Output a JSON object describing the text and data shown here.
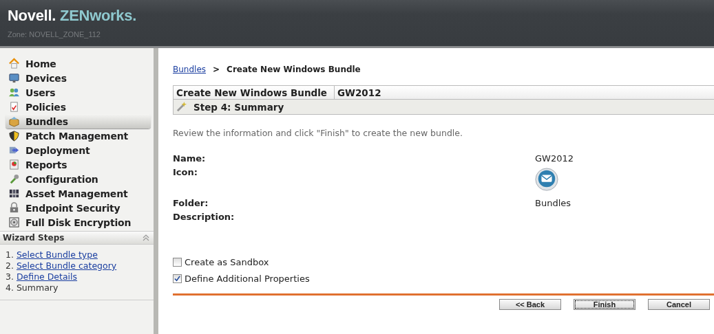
{
  "header": {
    "brand": "Novell.",
    "product": "ZENworks.",
    "zone": "Zone: NOVELL_ZONE_112"
  },
  "nav": {
    "items": [
      {
        "label": "Home",
        "selected": false
      },
      {
        "label": "Devices",
        "selected": false
      },
      {
        "label": "Users",
        "selected": false
      },
      {
        "label": "Policies",
        "selected": false
      },
      {
        "label": "Bundles",
        "selected": true
      },
      {
        "label": "Patch Management",
        "selected": false
      },
      {
        "label": "Deployment",
        "selected": false
      },
      {
        "label": "Reports",
        "selected": false
      },
      {
        "label": "Configuration",
        "selected": false
      },
      {
        "label": "Asset Management",
        "selected": false
      },
      {
        "label": "Endpoint Security",
        "selected": false
      },
      {
        "label": "Full Disk Encryption",
        "selected": false
      }
    ]
  },
  "wizard": {
    "title": "Wizard Steps",
    "expanded": true,
    "steps": [
      {
        "number": "1.",
        "label": "Select Bundle type",
        "kind": "link"
      },
      {
        "number": "2.",
        "label": "Select Bundle category",
        "kind": "link"
      },
      {
        "number": "3.",
        "label": "Define Details",
        "kind": "link"
      },
      {
        "number": "4.",
        "label": "Summary",
        "kind": "current"
      }
    ]
  },
  "breadcrumb": {
    "link": "Bundles",
    "separator": ">",
    "current": "Create New Windows Bundle"
  },
  "title_bar": {
    "title": "Create New Windows Bundle",
    "name": "GW2012",
    "step": "Step 4: Summary"
  },
  "instruction": "Review the information and click \"Finish\" to create the new bundle.",
  "fields": [
    {
      "label": "Name:",
      "kind": "text",
      "value": "GW2012"
    },
    {
      "label": "Icon:",
      "kind": "icon"
    },
    {
      "label": "Folder:",
      "kind": "text",
      "value": "Bundles"
    },
    {
      "label": "Description:",
      "kind": "text"
    }
  ],
  "options": [
    {
      "label": "Create as Sandbox",
      "checked": false
    },
    {
      "label": "Define Additional Properties",
      "checked": true
    }
  ],
  "buttons": [
    {
      "label": "<< Back",
      "focused": false
    },
    {
      "label": "Finish",
      "focused": true
    },
    {
      "label": "Cancel",
      "focused": false
    }
  ]
}
